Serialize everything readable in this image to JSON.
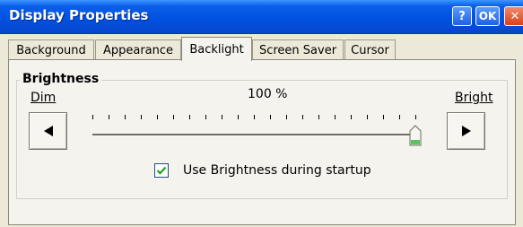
{
  "window": {
    "title": "Display Properties",
    "help_label": "?",
    "ok_label": "OK",
    "close_label": "✕"
  },
  "tabs": [
    {
      "label": "Background",
      "active": false
    },
    {
      "label": "Appearance",
      "active": false
    },
    {
      "label": "Backlight",
      "active": true
    },
    {
      "label": "Screen Saver",
      "active": false
    },
    {
      "label": "Cursor",
      "active": false
    }
  ],
  "brightness": {
    "group_label": "Brightness",
    "value_text": "100 %",
    "value": 1.0,
    "min_label": "Dim",
    "max_label": "Bright",
    "tick_count": 21
  },
  "startup_option": {
    "label": "Use Brightness during startup",
    "checked": true
  },
  "colors": {
    "titlebar": "#0050e0",
    "check": "#21a121",
    "thumb_base": "#5cc25c"
  },
  "icons": {
    "decrease": "left-triangle",
    "increase": "right-triangle",
    "check": "checkmark"
  }
}
